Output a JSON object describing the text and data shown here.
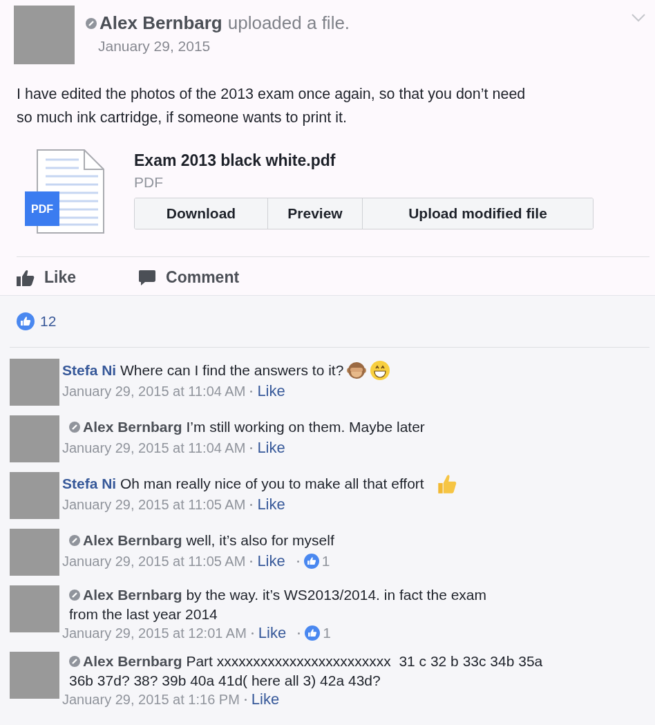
{
  "post": {
    "author": "Alex Bernbarg",
    "action": "uploaded a file.",
    "date": "January 29, 2015",
    "text": "I have edited the photos of the 2013 exam once again, so that you don’t need so much ink cartridge, if someone wants to print it."
  },
  "file": {
    "name": "Exam 2013 black white.pdf",
    "type": "PDF",
    "icon_label": "PDF",
    "buttons": [
      "Download",
      "Preview",
      "Upload modified file"
    ]
  },
  "actions": [
    "Like",
    "Comment"
  ],
  "reactions": {
    "count": "12"
  },
  "comments": [
    {
      "kind": "member",
      "author": "Stefa Ni",
      "text": "Where can I find the answers to it?",
      "emoji": [
        {
          "kind": "monkey"
        },
        {
          "kind": "grin"
        }
      ],
      "time": "January 29, 2015 at 11:04 AM",
      "like": "Like"
    },
    {
      "kind": "owner",
      "author": "Alex Bernbarg",
      "text": "I’m still working on them. Maybe later",
      "time": "January 29, 2015 at 11:04 AM",
      "like": "Like"
    },
    {
      "kind": "member",
      "author": "Stefa Ni",
      "text": "Oh man really nice of you to make all that effort",
      "emoji": [
        {
          "kind": "thumb"
        }
      ],
      "time": "January 29, 2015 at 11:05 AM",
      "like": "Like"
    },
    {
      "kind": "owner",
      "author": "Alex Bernbarg",
      "text": "well, it’s also for myself",
      "time": "January 29, 2015 at 11:05 AM",
      "like": "Like",
      "likes": "1"
    },
    {
      "kind": "owner",
      "author": "Alex Bernbarg",
      "text": "by the way. it’s WS2013/2014. in fact the exam\nfrom the last year 2014",
      "time": "January 29, 2015 at 12:01 AM",
      "like": "Like",
      "likes": "1"
    },
    {
      "kind": "owner",
      "author": "Alex Bernbarg",
      "text": "Part xxxxxxxxxxxxxxxxxxxxxxxx  31 c 32 b 33c 34b 35a\n36b 37d? 38? 39b 40a 41d( here all 3) 42a 43d?",
      "time": "January 29, 2015 at 1:16 PM",
      "like": "Like"
    }
  ]
}
